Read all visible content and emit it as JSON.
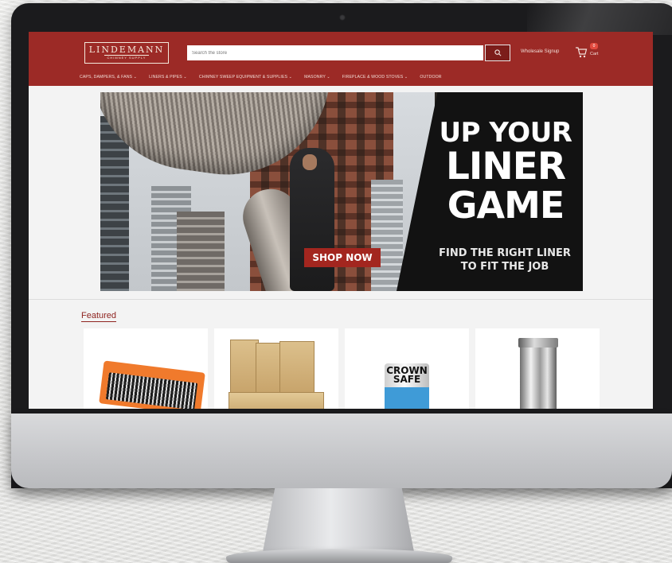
{
  "header": {
    "logo_main": "LINDEMANN",
    "logo_sub": "CHIMNEY SUPPLY",
    "search_placeholder": "Search the store",
    "wholesale_label": "Wholesale Signup",
    "cart_count": "0",
    "cart_label": "Cart"
  },
  "nav": {
    "items": [
      {
        "label": "CAPS, DAMPERS, & FANS ⌄"
      },
      {
        "label": "LINERS & PIPES ⌄"
      },
      {
        "label": "CHIMNEY SWEEP EQUIPMENT & SUPPLIES ⌄"
      },
      {
        "label": "MASONRY ⌄"
      },
      {
        "label": "FIREPLACE & WOOD STOVES ⌄"
      },
      {
        "label": "OUTDOOR"
      }
    ]
  },
  "hero": {
    "title_line1": "UP YOUR",
    "title_line2": "LINER",
    "title_line3": "GAME",
    "subtitle_line1": "FIND THE RIGHT LINER",
    "subtitle_line2": "TO FIT THE JOB",
    "cta_label": "SHOP NOW"
  },
  "featured": {
    "heading": "Featured",
    "products": [
      {
        "icon": "tool-kit-image"
      },
      {
        "icon": "firebrick-image"
      },
      {
        "icon": "sealant-can-image",
        "label_line1": "CROWN",
        "label_line2": "SAFE"
      },
      {
        "icon": "chimney-pipe-image"
      }
    ]
  },
  "colors": {
    "header_bg": "#9c2a26",
    "accent": "#8f2420",
    "cta_bg": "#a3261f",
    "badge": "#e24a3f"
  }
}
